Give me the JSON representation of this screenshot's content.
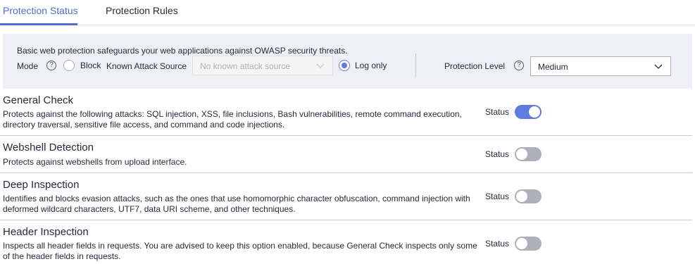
{
  "tabs": [
    {
      "label": "Protection Status",
      "active": true
    },
    {
      "label": "Protection Rules",
      "active": false
    }
  ],
  "panel": {
    "description": "Basic web protection safeguards your web applications against OWASP security threats.",
    "mode_label": "Mode",
    "help_glyph": "?",
    "block_label": "Block",
    "known_attack_source_label": "Known Attack Source",
    "known_attack_source_value": "No known attack source",
    "log_only_label": "Log only",
    "selected_mode": "Log only",
    "protection_level_label": "Protection Level",
    "protection_level_value": "Medium"
  },
  "sections": [
    {
      "title": "General Check",
      "description": "Protects against the following attacks: SQL injection, XSS, file inclusions, Bash vulnerabilities, remote command execution, directory traversal, sensitive file access, and command and code injections.",
      "status_label": "Status",
      "enabled": true
    },
    {
      "title": "Webshell Detection",
      "description": "Protects against webshells from upload interface.",
      "status_label": "Status",
      "enabled": false
    },
    {
      "title": "Deep Inspection",
      "description": "Identifies and blocks evasion attacks, such as the ones that use homomorphic character obfuscation, command injection with deformed wildcard characters, UTF7, data URI scheme, and other techniques.",
      "status_label": "Status",
      "enabled": false
    },
    {
      "title": "Header Inspection",
      "description": "Inspects all header fields in requests. You are advised to keep this option enabled, because General Check inspects only some of the header fields in requests.",
      "status_label": "Status",
      "enabled": false
    }
  ],
  "colors": {
    "accent": "#5e7ce0",
    "active_tab": "#526ecc",
    "toggle_off": "#adb0b8",
    "panel_bg": "#eef0f5"
  },
  "icons": {
    "help": "help-circle-icon",
    "dropdown": "chevron-down-icon"
  }
}
